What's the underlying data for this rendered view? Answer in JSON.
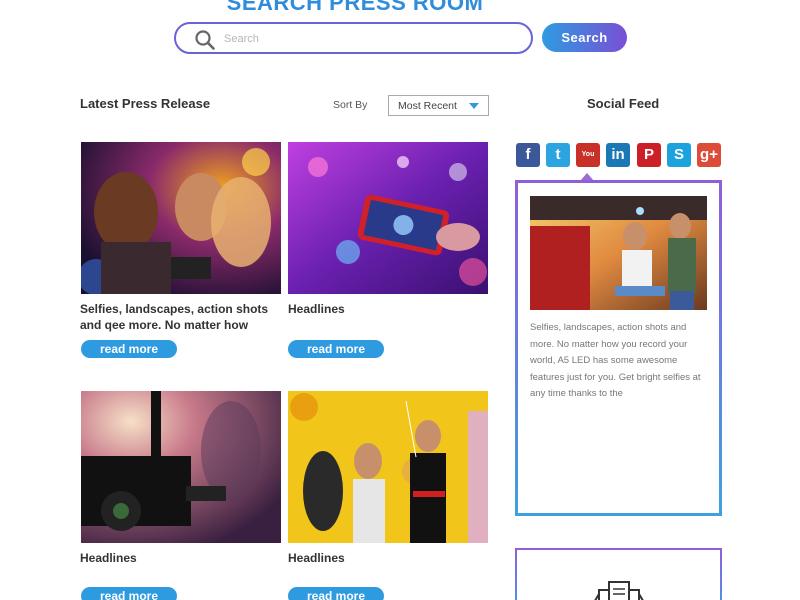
{
  "header": {
    "title": "SEARCH PRESS ROOM",
    "search_placeholder": "Search",
    "search_button": "Search"
  },
  "press": {
    "section_title": "Latest Press Release",
    "sort_label": "Sort By",
    "sort_value": "Most Recent",
    "cards": [
      {
        "title": "Selfies, landscapes, action shots and qee more. No matter how",
        "button": "read more",
        "image": "friends-selfie-photo"
      },
      {
        "title": "Headlines",
        "button": "read more",
        "image": "phone-concert-photo"
      },
      {
        "title": "Headlines",
        "button": "read more",
        "image": "video-camera-photo"
      },
      {
        "title": "Headlines",
        "button": "read more",
        "image": "party-balloons-photo"
      }
    ]
  },
  "social": {
    "title": "Social Feed",
    "icons": [
      {
        "name": "facebook-icon",
        "glyph": "f",
        "color": "#3b5998"
      },
      {
        "name": "twitter-icon",
        "glyph": "t",
        "color": "#2ba4e0"
      },
      {
        "name": "youtube-icon",
        "glyph": "You Tube",
        "color": "#c8312a"
      },
      {
        "name": "linkedin-icon",
        "glyph": "in",
        "color": "#1a78b5"
      },
      {
        "name": "pinterest-icon",
        "glyph": "P",
        "color": "#cb2027"
      },
      {
        "name": "skype-icon",
        "glyph": "S",
        "color": "#1ea2de"
      },
      {
        "name": "google-plus-icon",
        "glyph": "g+",
        "color": "#dd4b39"
      }
    ],
    "feed_text": "Selfies, landscapes, action shots and more. No matter how you record your world, A5 LED has some awesome features just for you. Get bright selfies at any time thanks to the"
  },
  "colors": {
    "accent_blue": "#2e9be0",
    "accent_purple": "#7a4fd6"
  }
}
